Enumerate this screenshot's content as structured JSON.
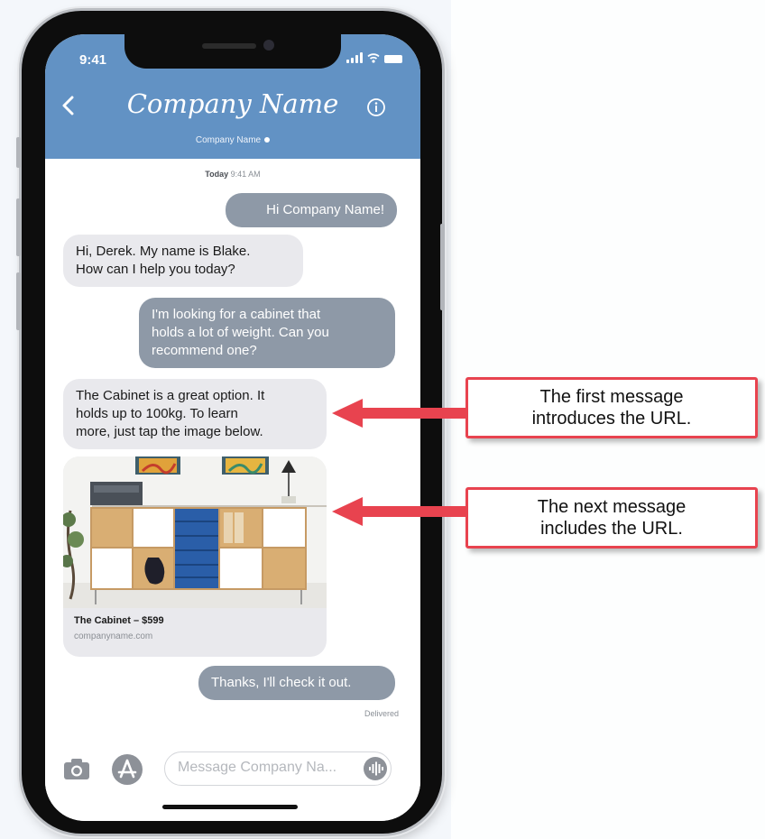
{
  "colors": {
    "header": "#6292c4",
    "outgoing_bubble": "#8e99a7",
    "incoming_bubble": "#e9e9ed",
    "callout_border": "#e8434f",
    "arrow": "#e8434f"
  },
  "status_bar": {
    "time": "9:41"
  },
  "header": {
    "title": "Company Name",
    "subtitle": "Company Name",
    "back_icon": "chevron-left-icon",
    "info_icon": "info-icon"
  },
  "chat": {
    "timestamp_day": "Today",
    "timestamp_time": "9:41 AM",
    "messages": [
      {
        "sender": "user",
        "lines": [
          "Hi Company Name!"
        ]
      },
      {
        "sender": "company",
        "lines": [
          "Hi, Derek. My name is Blake.",
          "How can I help you today?"
        ]
      },
      {
        "sender": "user",
        "lines": [
          "I'm looking for a cabinet that",
          "holds a lot of weight. Can you",
          "recommend one?"
        ]
      },
      {
        "sender": "company",
        "lines": [
          "The Cabinet is a great option. It",
          "holds up to 100kg. To learn",
          "more, just tap the image below."
        ]
      },
      {
        "sender": "user",
        "lines": [
          "Thanks, I'll check it out."
        ]
      }
    ],
    "link_card": {
      "title": "The Cabinet – $599",
      "domain": "companyname.com"
    },
    "delivered": "Delivered"
  },
  "compose": {
    "placeholder": "Message Company Na...",
    "camera_icon": "camera-icon",
    "apps_icon": "app-store-icon",
    "audio_icon": "audio-waveform-icon"
  },
  "callouts": [
    {
      "line1": "The first message",
      "line2": "introduces the URL."
    },
    {
      "line1": "The next message",
      "line2": "includes the URL."
    }
  ]
}
